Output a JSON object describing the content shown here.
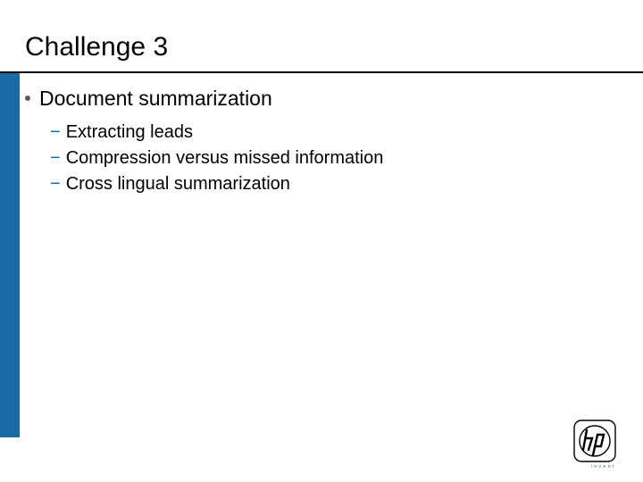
{
  "slide": {
    "title": "Challenge 3",
    "bullet": {
      "text": "Document summarization",
      "subs": [
        "Extracting leads",
        "Compression versus missed information",
        "Cross lingual summarization"
      ]
    },
    "logo": {
      "name": "hp-logo",
      "tagline": "invent"
    }
  }
}
